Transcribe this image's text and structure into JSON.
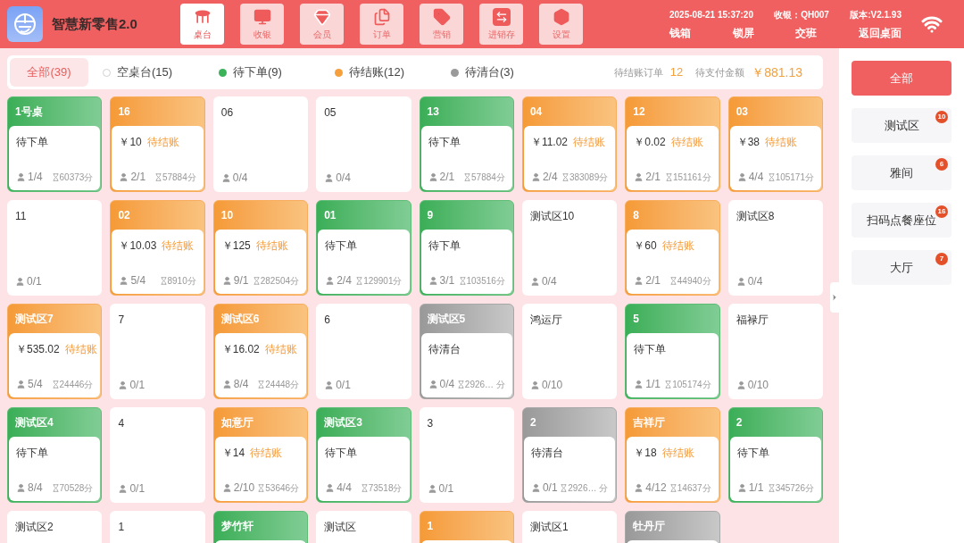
{
  "app": {
    "title": "智慧新零售2.0"
  },
  "nav": [
    {
      "label": "桌台",
      "selected": true
    },
    {
      "label": "收银",
      "selected": false
    },
    {
      "label": "会员",
      "selected": false
    },
    {
      "label": "订单",
      "selected": false
    },
    {
      "label": "营销",
      "selected": false
    },
    {
      "label": "进销存",
      "selected": false
    },
    {
      "label": "设置",
      "selected": false
    }
  ],
  "header_info": {
    "datetime": "2025-08-21 15:37:20",
    "cashier": "收银：QH007",
    "version": "版本:V2.1.93"
  },
  "header_actions": [
    "钱箱",
    "锁屏",
    "交班",
    "返回桌面"
  ],
  "filters": [
    {
      "label": "全部(39)",
      "selected": true,
      "kind": "all"
    },
    {
      "label": "空桌台(15)",
      "selected": false,
      "kind": "empty"
    },
    {
      "label": "待下单(9)",
      "selected": false,
      "kind": "pending_order"
    },
    {
      "label": "待结账(12)",
      "selected": false,
      "kind": "pending_checkout"
    },
    {
      "label": "待清台(3)",
      "selected": false,
      "kind": "pending_clear"
    }
  ],
  "summary": {
    "orders_label": "待结账订单",
    "orders_value": "12",
    "amount_label": "待支付金额",
    "amount_value": "￥881.13"
  },
  "tables": [
    {
      "name": "1号桌",
      "kind": "pending_order",
      "status": "待下单",
      "guests": "1/4",
      "minutes": "60373分"
    },
    {
      "name": "16",
      "kind": "pending_checkout",
      "amount": "￥10",
      "status": "待结账",
      "guests": "2/1",
      "minutes": "57884分"
    },
    {
      "name": "06",
      "kind": "empty",
      "guests": "0/4"
    },
    {
      "name": "05",
      "kind": "empty",
      "guests": "0/4"
    },
    {
      "name": "13",
      "kind": "pending_order",
      "status": "待下单",
      "guests": "2/1",
      "minutes": "57884分"
    },
    {
      "name": "04",
      "kind": "pending_checkout",
      "amount": "￥11.02",
      "status": "待结账",
      "guests": "2/4",
      "minutes": "383089分"
    },
    {
      "name": "12",
      "kind": "pending_checkout",
      "amount": "￥0.02",
      "status": "待结账",
      "guests": "2/1",
      "minutes": "151161分"
    },
    {
      "name": "03",
      "kind": "pending_checkout",
      "amount": "￥38",
      "status": "待结账",
      "guests": "4/4",
      "minutes": "105171分"
    },
    {
      "name": "11",
      "kind": "empty",
      "guests": "0/1"
    },
    {
      "name": "02",
      "kind": "pending_checkout",
      "amount": "￥10.03",
      "status": "待结账",
      "guests": "5/4",
      "minutes": "8910分"
    },
    {
      "name": "10",
      "kind": "pending_checkout",
      "amount": "￥125",
      "status": "待结账",
      "guests": "9/1",
      "minutes": "282504分"
    },
    {
      "name": "01",
      "kind": "pending_order",
      "status": "待下单",
      "guests": "2/4",
      "minutes": "129901分"
    },
    {
      "name": "9",
      "kind": "pending_order",
      "status": "待下单",
      "guests": "3/1",
      "minutes": "103516分"
    },
    {
      "name": "测试区10",
      "kind": "empty",
      "guests": "0/4"
    },
    {
      "name": "8",
      "kind": "pending_checkout",
      "amount": "￥60",
      "status": "待结账",
      "guests": "2/1",
      "minutes": "44940分"
    },
    {
      "name": "测试区8",
      "kind": "empty",
      "guests": "0/4"
    },
    {
      "name": "测试区7",
      "kind": "pending_checkout",
      "amount": "￥535.02",
      "status": "待结账",
      "guests": "5/4",
      "minutes": "24446分"
    },
    {
      "name": "7",
      "kind": "empty",
      "guests": "0/1"
    },
    {
      "name": "测试区6",
      "kind": "pending_checkout",
      "amount": "￥16.02",
      "status": "待结账",
      "guests": "8/4",
      "minutes": "24448分"
    },
    {
      "name": "6",
      "kind": "empty",
      "guests": "0/1"
    },
    {
      "name": "测试区5",
      "kind": "pending_clear",
      "status": "待清台",
      "guests": "0/4",
      "minutes": "2926… 分"
    },
    {
      "name": "鸿运厅",
      "kind": "empty",
      "guests": "0/10"
    },
    {
      "name": "5",
      "kind": "pending_order",
      "status": "待下单",
      "guests": "1/1",
      "minutes": "105174分"
    },
    {
      "name": "福禄厅",
      "kind": "empty",
      "guests": "0/10"
    },
    {
      "name": "测试区4",
      "kind": "pending_order",
      "status": "待下单",
      "guests": "8/4",
      "minutes": "70528分"
    },
    {
      "name": "4",
      "kind": "empty",
      "guests": "0/1"
    },
    {
      "name": "如意厅",
      "kind": "pending_checkout",
      "amount": "￥14",
      "status": "待结账",
      "guests": "2/10",
      "minutes": "53646分"
    },
    {
      "name": "测试区3",
      "kind": "pending_order",
      "status": "待下单",
      "guests": "4/4",
      "minutes": "73518分"
    },
    {
      "name": "3",
      "kind": "empty",
      "guests": "0/1"
    },
    {
      "name": "2",
      "kind": "pending_clear",
      "status": "待清台",
      "guests": "0/1",
      "minutes": "2926… 分"
    },
    {
      "name": "吉祥厅",
      "kind": "pending_checkout",
      "amount": "￥18",
      "status": "待结账",
      "guests": "4/12",
      "minutes": "14637分"
    },
    {
      "name": "2",
      "kind": "pending_order",
      "status": "待下单",
      "guests": "1/1",
      "minutes": "345726分"
    },
    {
      "name": "测试区2",
      "kind": "empty"
    },
    {
      "name": "1",
      "kind": "empty"
    },
    {
      "name": "梦竹轩",
      "kind": "pending_order"
    },
    {
      "name": "测试区",
      "kind": "empty"
    },
    {
      "name": "1",
      "kind": "pending_checkout"
    },
    {
      "name": "测试区1",
      "kind": "empty"
    },
    {
      "name": "牡丹厅",
      "kind": "pending_clear"
    }
  ],
  "areas": [
    {
      "label": "全部",
      "selected": true
    },
    {
      "label": "测试区",
      "badge": "10",
      "selected": false
    },
    {
      "label": "雅间",
      "badge": "6",
      "selected": false
    },
    {
      "label": "扫码点餐座位",
      "badge": "16",
      "selected": false
    },
    {
      "label": "大厅",
      "badge": "7",
      "selected": false
    }
  ]
}
